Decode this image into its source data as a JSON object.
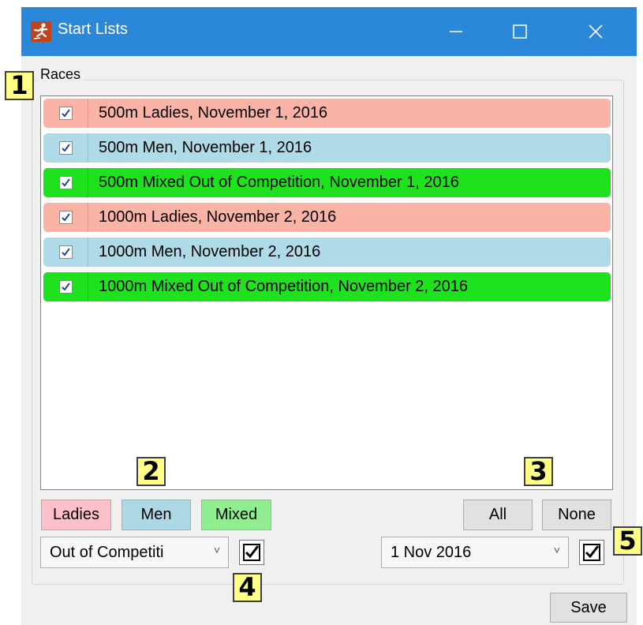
{
  "window": {
    "title": "Start Lists",
    "titlebar_color": "#2b88d8"
  },
  "races_group": {
    "label": "Races",
    "items": [
      {
        "label": "500m Ladies, November 1, 2016",
        "checked": true,
        "color": "#fbb3a6"
      },
      {
        "label": "500m Men, November 1, 2016",
        "checked": true,
        "color": "#afdbe8"
      },
      {
        "label": "500m Mixed Out of Competition, November 1, 2016",
        "checked": true,
        "color": "#1de21d"
      },
      {
        "label": "1000m Ladies, November 2, 2016",
        "checked": true,
        "color": "#fbb3a6"
      },
      {
        "label": "1000m Men, November 2, 2016",
        "checked": true,
        "color": "#afdbe8"
      },
      {
        "label": "1000m Mixed Out of Competition, November 2, 2016",
        "checked": true,
        "color": "#1de21d"
      }
    ]
  },
  "filters": {
    "ladies_label": "Ladies",
    "ladies_color": "#ffc0cb",
    "men_label": "Men",
    "men_color": "#add8e6",
    "mixed_label": "Mixed",
    "mixed_color": "#90ee90",
    "all_label": "All",
    "none_label": "None"
  },
  "competition_select": {
    "value": "Out of Competiti",
    "checked": true
  },
  "date_select": {
    "value": "1 Nov 2016",
    "checked": true
  },
  "save_label": "Save",
  "callouts": [
    "1",
    "2",
    "3",
    "4",
    "5"
  ]
}
